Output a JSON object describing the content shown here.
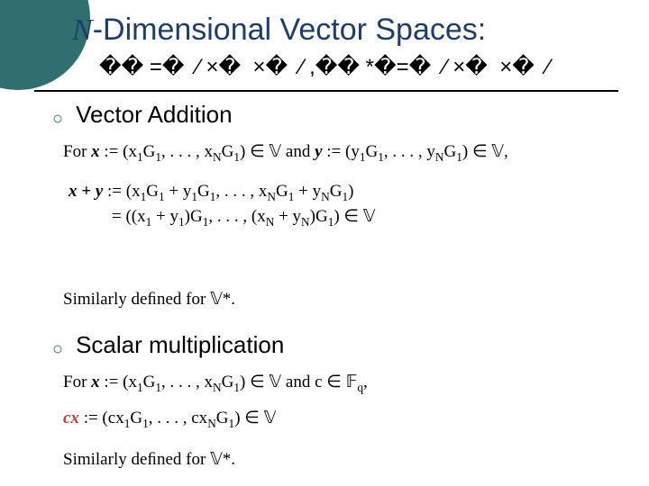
{
  "title_prefix_italic": "N",
  "title_rest": "-Dimensional Vector Spaces:",
  "garbled_subtitle": "�� =�  ⁄ ×�  ×�  ⁄ ,�� *�=�  ⁄ ×�  ×�  ⁄",
  "bullets": {
    "addition": "Vector Addition",
    "scalar": "Scalar multiplication"
  },
  "bullet_glyph": "○",
  "math": {
    "for1_pre": "For ",
    "for1_x": "x",
    "for1_xdef": " := (x",
    "for1_x1g": "G",
    "for1_mid": ", . . . , x",
    "for1_xng": "G",
    "for1_close": ") ∈ ",
    "for1_V": "𝕍",
    "for1_and_pre": "   and   ",
    "for1_y": "y",
    "for1_ydef": " := (y",
    "for1_yg": "G",
    "for1_ymid": ", . . . , y",
    "for1_yng": "G",
    "for1_yclose": ") ∈ ",
    "for1_V2": "𝕍,",
    "xpy_l1_lhs": "x + y",
    "xpy_l1_eq": " := (x",
    "xpy_l1_g1": "G",
    "xpy_l1_plus": " + y",
    "xpy_l1_g1b": "G",
    "xpy_l1_mid": ", . . . , x",
    "xpy_l1_gN": "G",
    "xpy_l1_plus2": " + y",
    "xpy_l1_gNb": "G",
    "xpy_l1_close": ")",
    "xpy_l2_a": "= ((x",
    "xpy_l2_plus": " + y",
    "xpy_l2_g": ")G",
    "xpy_l2_mid": ", . . . , (x",
    "xpy_l2_plus2": " + y",
    "xpy_l2_g2": ")G",
    "xpy_l2_close": ") ∈ ",
    "xpy_l2_V": "𝕍",
    "sim1": "Similarly deﬁned for ",
    "Vstar1": "𝕍*.",
    "for2_pre": "For ",
    "for2_x": "x",
    "for2_def": " := (x",
    "for2_g": "G",
    "for2_mid": ", . . . , x",
    "for2_gN": "G",
    "for2_close": ") ∈ ",
    "for2_V": "𝕍",
    "for2_and": "   and   ",
    "for2_c": "c",
    "for2_cin": " ∈ ",
    "for2_F": "𝔽",
    "for2_q": ",",
    "cx_lhs": "cx",
    "cx_rhs": " := (cx",
    "cx_g": "G",
    "cx_mid": ", . . . , cx",
    "cx_gN": "G",
    "cx_close": ") ∈ ",
    "cx_V": "𝕍",
    "sim2": "Similarly deﬁned for ",
    "Vstar2": "𝕍*.",
    "s_one": "1",
    "s_N": "N"
  }
}
